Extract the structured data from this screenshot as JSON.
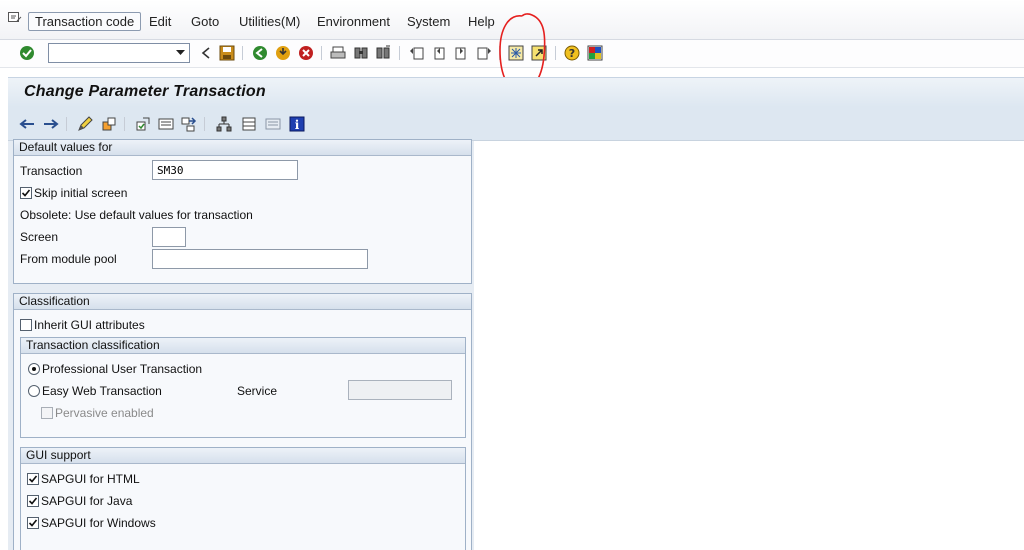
{
  "menu": {
    "transaction_code": "Transaction code",
    "edit": "Edit",
    "goto": "Goto",
    "utilities": "Utilities(M)",
    "environment": "Environment",
    "system": "System",
    "help": "Help"
  },
  "toolbar": {
    "command_field_value": "",
    "icons": [
      "enter-icon",
      "back-icon",
      "save-icon",
      "back-green-icon",
      "exit-icon",
      "cancel-icon",
      "print-icon",
      "find-icon",
      "find-next-icon",
      "first-page-icon",
      "previous-page-icon",
      "next-page-icon",
      "last-page-icon",
      "create-session-icon",
      "shortcut-icon",
      "help-icon",
      "layout-icon"
    ]
  },
  "title": "Change Parameter Transaction",
  "default_values": {
    "header": "Default values for",
    "transaction_label": "Transaction",
    "transaction_value": "SM30",
    "skip_initial_screen_label": "Skip initial screen",
    "skip_initial_screen_checked": true,
    "obsolete_text": "Obsolete: Use default values for transaction",
    "screen_label": "Screen",
    "screen_value": "",
    "module_pool_label": "From module pool",
    "module_pool_value": ""
  },
  "classification": {
    "header": "Classification",
    "inherit_gui_label": "Inherit GUI attributes",
    "inherit_gui_checked": false,
    "transaction_classification": {
      "header": "Transaction classification",
      "professional_label": "Professional User Transaction",
      "easy_web_label": "Easy Web Transaction",
      "selected": "professional",
      "service_label": "Service",
      "service_value": "",
      "pervasive_label": "Pervasive enabled",
      "pervasive_checked": false
    },
    "gui_support": {
      "header": "GUI support",
      "html_label": "SAPGUI for HTML",
      "java_label": "SAPGUI for Java",
      "windows_label": "SAPGUI for Windows",
      "html_checked": true,
      "java_checked": true,
      "windows_checked": true
    }
  },
  "colors": {
    "title_bg": "#dde7f1",
    "annotation": "#e5201f"
  }
}
